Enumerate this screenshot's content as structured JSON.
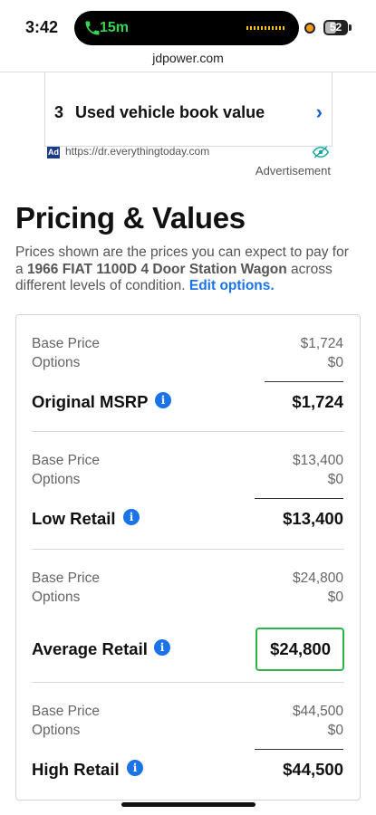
{
  "status_bar": {
    "time": "3:42",
    "call_timer": "15m",
    "battery_level": "52",
    "battery_level_fraction": 0.52,
    "call_color": "#39d353"
  },
  "browser": {
    "url": "jdpower.com"
  },
  "ad": {
    "number": "3",
    "title": "Used vehicle book value",
    "tag": "Ad",
    "source_url": "https://dr.everythingtoday.com",
    "label": "Advertisement"
  },
  "section": {
    "title": "Pricing & Values",
    "desc_prefix": "Prices shown are the prices you can expect to pay for a ",
    "vehicle": "1966 FIAT 1100D 4 Door Station Wagon",
    "desc_suffix": " across different levels of condition. ",
    "edit_link": "Edit options."
  },
  "pricing": [
    {
      "base_label": "Base Price",
      "base_value": "$1,724",
      "options_label": "Options",
      "options_value": "$0",
      "total_label": "Original MSRP",
      "total_value": "$1,724"
    },
    {
      "base_label": "Base Price",
      "base_value": "$13,400",
      "options_label": "Options",
      "options_value": "$0",
      "total_label": "Low Retail",
      "total_value": "$13,400"
    },
    {
      "base_label": "Base Price",
      "base_value": "$24,800",
      "options_label": "Options",
      "options_value": "$0",
      "total_label": "Average Retail",
      "total_value": "$24,800",
      "highlighted": true
    },
    {
      "base_label": "Base Price",
      "base_value": "$44,500",
      "options_label": "Options",
      "options_value": "$0",
      "total_label": "High Retail",
      "total_value": "$44,500"
    }
  ],
  "colors": {
    "accent": "#1a73e8",
    "highlight_border": "#2cb34a",
    "ad_chevron": "#1a5ecf"
  }
}
